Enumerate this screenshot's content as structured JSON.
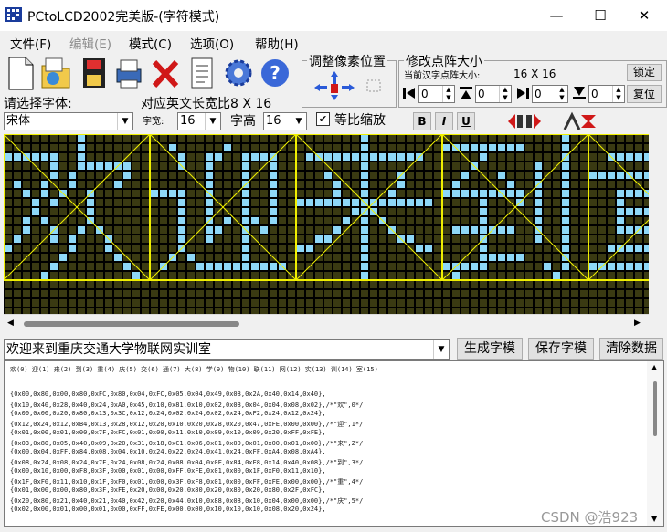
{
  "window": {
    "title": "PCtoLCD2002完美版-(字符模式)",
    "minimize": "—",
    "maximize": "☐",
    "close": "✕"
  },
  "menu": [
    "文件(F)",
    "编辑(E)",
    "模式(C)",
    "选项(O)",
    "帮助(H)"
  ],
  "toolbar_icons": [
    "new-icon",
    "open-icon",
    "save-icon",
    "print-icon",
    "delete-icon",
    "notes-icon",
    "settings-gear-icon",
    "help-icon"
  ],
  "pixel_pos_group": {
    "title": "调整像素位置"
  },
  "size_group": {
    "title": "修改点阵大小",
    "current_label": "当前汉字点阵大小:",
    "current_value": "16 X 16",
    "lock_button": "锁定",
    "reset_button": "复位",
    "spin_values": [
      "0",
      "0",
      "0",
      "0"
    ]
  },
  "font": {
    "choose_label": "请选择字体:",
    "ascii_size_label": "对应英文长宽比8 X 16",
    "font_name": "宋体",
    "width_label": "字宽:",
    "width_value": "16",
    "height_label": "字高",
    "height_value": "16",
    "scale_label": "等比缩放",
    "scale_checked": "✔",
    "bold": "B",
    "italic": "I",
    "underline": "U"
  },
  "input": {
    "text": "欢迎来到重庆交通大学物联网实训室",
    "generate_button": "生成字模",
    "save_button": "保存字模",
    "clear_button": "清除数据"
  },
  "output": {
    "index_line": "欢(0) 迎(1) 来(2) 到(3) 重(4) 庆(5) 交(6) 通(7) 大(8) 学(9) 物(10) 联(11) 网(12) 实(13) 训(14) 室(15)",
    "lines": [
      "{0x00,0x80,0x00,0x80,0xFC,0x80,0x04,0xFC,0x05,0x04,0x49,0x08,0x2A,0x40,0x14,0x40},",
      "{0x10,0x40,0x28,0x40,0x24,0xA0,0x45,0x10,0x81,0x10,0x02,0x08,0x04,0x04,0x08,0x02},/*\"欢\",0*/",
      "{0x00,0x00,0x20,0x80,0x13,0x3C,0x12,0x24,0x02,0x24,0x02,0x24,0xF2,0x24,0x12,0x24},",
      "{0x12,0x24,0x12,0xB4,0x13,0x28,0x12,0x20,0x10,0x20,0x28,0x20,0x47,0xFE,0x00,0x00},/*\"迎\",1*/",
      "{0x01,0x00,0x01,0x00,0x7F,0xFC,0x01,0x00,0x11,0x10,0x09,0x10,0x09,0x20,0xFF,0xFE},",
      "{0x03,0x80,0x05,0x40,0x09,0x20,0x31,0x18,0xC1,0x06,0x01,0x00,0x01,0x00,0x01,0x00},/*\"来\",2*/",
      "{0x00,0x04,0xFF,0x84,0x08,0x04,0x10,0x24,0x22,0x24,0x41,0x24,0xFF,0xA4,0x08,0xA4},",
      "{0x08,0x24,0x08,0x24,0x7F,0x24,0x08,0x24,0x08,0x04,0x0F,0x84,0xF8,0x14,0x40,0x08},/*\"到\",3*/",
      "{0x00,0x10,0x00,0xF8,0x3F,0x00,0x01,0x00,0xFF,0xFE,0x01,0x00,0x1F,0xF0,0x11,0x10},",
      "{0x1F,0xF0,0x11,0x10,0x1F,0xF0,0x01,0x00,0x3F,0xF8,0x01,0x00,0xFF,0xFE,0x00,0x00},/*\"重\",4*/",
      "{0x01,0x00,0x00,0x80,0x3F,0xFE,0x20,0x00,0x20,0x80,0x20,0x80,0x20,0x80,0x2F,0xFC},",
      "{0x20,0x80,0x21,0x40,0x21,0x40,0x42,0x20,0x44,0x10,0x88,0x08,0x10,0x04,0x00,0x00},/*\"庆\",5*/",
      "{0x02,0x00,0x01,0x00,0x01,0x00,0xFF,0xFE,0x00,0x00,0x10,0x10,0x10,0x08,0x20,0x24},"
    ]
  },
  "watermark": "CSDN @浩923",
  "lcd": {
    "off_color": "#3a3a12",
    "on_color": "#8ed8f8",
    "grid_color": "#000000",
    "divider_color": "#f0f000"
  }
}
